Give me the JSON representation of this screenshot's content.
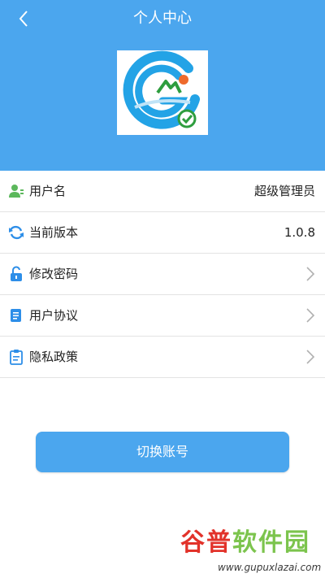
{
  "header": {
    "title": "个人中心",
    "back_icon": "chevron-left-icon",
    "bg_color": "#4ba6ee"
  },
  "logo": {
    "icon": "app-logo-g-mountain-check"
  },
  "rows": [
    {
      "label": "用户名",
      "value": "超级管理员",
      "icon": "user-icon"
    },
    {
      "label": "当前版本",
      "value": "1.0.8",
      "icon": "refresh-icon"
    },
    {
      "label": "修改密码",
      "icon": "unlock-icon",
      "chevron": true
    },
    {
      "label": "用户协议",
      "icon": "document-icon",
      "chevron": true
    },
    {
      "label": "隐私政策",
      "icon": "clipboard-icon",
      "chevron": true
    }
  ],
  "switch_button": {
    "label": "切换账号"
  },
  "watermark": {
    "text_part1": "谷普",
    "text_part2": "软件园",
    "url": "www.gupuxlazai.com"
  },
  "colors": {
    "accent": "#4ba6ee",
    "icon_green": "#5cb85c",
    "icon_blue": "#2d8ee8",
    "chevron": "#b0b0b0"
  }
}
